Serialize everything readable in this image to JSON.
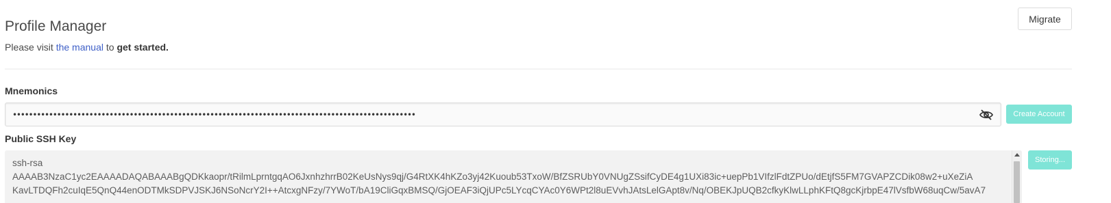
{
  "header": {
    "title": "Profile Manager",
    "migrate_label": "Migrate"
  },
  "intro": {
    "prefix": "Please visit ",
    "link_text": "the manual",
    "middle": " to ",
    "emphasis": "get started."
  },
  "mnemonics": {
    "label": "Mnemonics",
    "masked_value": "••••••••••••••••••••••••••••••••••••••••••••••••••••••••••••••••••••••••••••••••••••••••••••••••••••",
    "visibility_icon": "eye-slash-icon",
    "create_account_label": "Create Account"
  },
  "ssh": {
    "label": "Public SSH Key",
    "line1": "ssh-rsa",
    "line2": "AAAAB3NzaC1yc2EAAAADAQABAAABgQDKkaopr/tRilmLprntgqAO6JxnhzhrrB02KeUsNys9qj/G4RtXK4hKZo3yj42Kuoub53TxoW/BfZSRUbY0VNUgZSsifCyDE4g1UXi83ic+uepPb1VIfzlFdtZPUo/dEtjfS5FM7GVAPZCDik08w2+uXeZiA",
    "line3": "KavLTDQFh2cuIqE5QnQ44enODTMkSDPVJSKJ6NSoNcrY2I++AtcxgNFzy/7YWoT/bA19CliGqxBMSQ/GjOEAF3iQjUPc5LYcqCYAc0Y6WPt2l8uEVvhJAtsLelGApt8v/Nq/OBEKJpUQB2cfkyKlwLLphKFtQ8gcKjrbpE47lVsfbW68uqCw/5avA7",
    "storing_label": "Storing..."
  },
  "colors": {
    "link": "#3e5fc7",
    "accent_teal": "#7fe4d7"
  }
}
